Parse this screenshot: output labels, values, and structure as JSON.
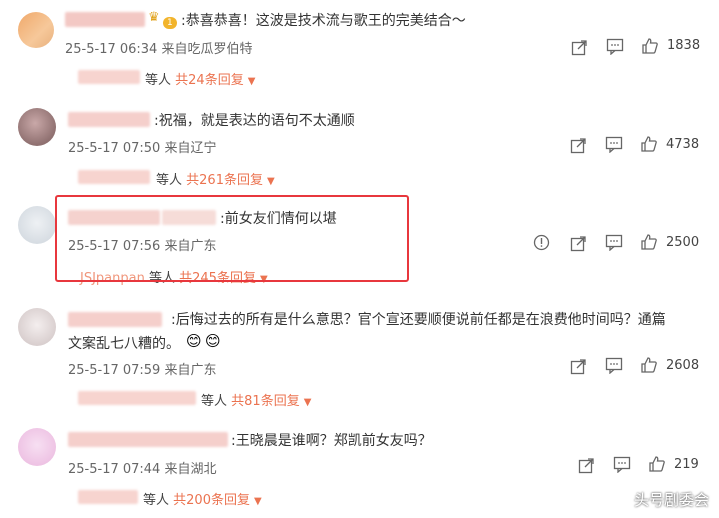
{
  "comments": [
    {
      "text": ":恭喜恭喜！这波是技术流与歌王的完美结合～",
      "meta": "25-5-17 06:34 来自吃瓜罗伯特",
      "likes": "1838",
      "reply_prefix": "等人",
      "reply_count": "共24条回复"
    },
    {
      "text": ":祝福，就是表达的语句不太通顺",
      "meta": "25-5-17 07:50 来自辽宁",
      "likes": "4738",
      "reply_prefix": "等人",
      "reply_count": "共261条回复"
    },
    {
      "text": ":前女友们情何以堪",
      "meta": "25-5-17 07:56 来自广东",
      "likes": "2500",
      "reply_user": "JSJpanpan",
      "reply_prefix": "等人",
      "reply_count": "共245条回复"
    },
    {
      "text": ":后悔过去的所有是什么意思？官个宣还要顺便说前任都是在浪费他时间吗？通篇",
      "text2": "文案乱七八糟的。",
      "meta": "25-5-17 07:59 来自广东",
      "likes": "2608",
      "reply_prefix": "等人",
      "reply_count": "共81条回复"
    },
    {
      "text": ":王晓晨是谁啊？郑凯前女友吗？",
      "meta": "25-5-17 07:44 来自湖北",
      "likes": "219",
      "reply_prefix": "等人",
      "reply_count": "共200条回复"
    }
  ],
  "badge_text": "1",
  "watermark": "头号剧委会",
  "colors": {
    "accent": "#eb7350",
    "highlight": "#e8373d"
  }
}
